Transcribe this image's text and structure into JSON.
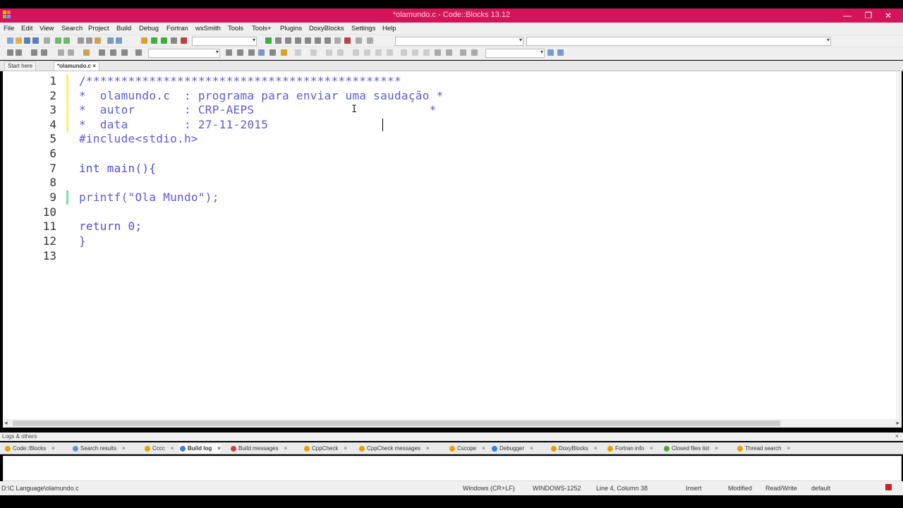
{
  "window": {
    "title": "*olamundo.c - Code::Blocks 13.12",
    "minimize": "—",
    "maximize": "❐",
    "close": "✕"
  },
  "menu": [
    "File",
    "Edit",
    "View",
    "Search",
    "Project",
    "Build",
    "Debug",
    "Fortran",
    "wxSmith",
    "Tools",
    "Tools+",
    "Plugins",
    "DoxyBlocks",
    "Settings",
    "Help"
  ],
  "tabs": [
    {
      "label": "Start here",
      "active": false
    },
    {
      "label": "*olamundo.c",
      "close": "×",
      "active": true
    }
  ],
  "editor": {
    "line_numbers": [
      "1",
      "2",
      "3",
      "4",
      "5",
      "6",
      "7",
      "8",
      "9",
      "10",
      "11",
      "12",
      "13"
    ],
    "lines": [
      "/*********************************************",
      "*  olamundo.c  : programa para enviar uma saudação *",
      "*  autor       : CRP-AEPS                         *",
      "*  data        : 27-11-2015",
      "#include<stdio.h>",
      "",
      "int main(){",
      "",
      "printf(\"Ola Mundo\");",
      "",
      "return 0;",
      "}",
      ""
    ]
  },
  "logs": {
    "header": "Logs & others",
    "tabs": [
      {
        "label": "Code::Blocks",
        "icon_color": "#e8a000"
      },
      {
        "label": "Search results",
        "icon_color": "#6a8fd0"
      },
      {
        "label": "Cccc",
        "icon_color": "#e8a000"
      },
      {
        "label": "Build log",
        "icon_color": "#3a7fd8",
        "active": true
      },
      {
        "label": "Build messages",
        "icon_color": "#d04040"
      },
      {
        "label": "CppCheck",
        "icon_color": "#e8a000"
      },
      {
        "label": "CppCheck messages",
        "icon_color": "#e8a000"
      },
      {
        "label": "Cscope",
        "icon_color": "#e8a000"
      },
      {
        "label": "Debugger",
        "icon_color": "#3a7fd8"
      },
      {
        "label": "DoxyBlocks",
        "icon_color": "#e8a000"
      },
      {
        "label": "Fortran info",
        "icon_color": "#e8a000"
      },
      {
        "label": "Closed files list",
        "icon_color": "#5aa040"
      },
      {
        "label": "Thread search",
        "icon_color": "#e8a000"
      }
    ],
    "close_glyph": "×"
  },
  "status": {
    "path": "D:\\C Language\\olamundo.c",
    "eol": "Windows (CR+LF)",
    "encoding": "WINDOWS-1252",
    "position": "Line 4, Column 38",
    "mode": "Insert",
    "modified": "Modified",
    "access": "Read/Write",
    "profile": "default"
  },
  "colors": {
    "titlebar": "#d4145a",
    "code_text": "#5c5cd6",
    "fold_margin": "#ffee77",
    "changed_line_marker": "#7be0a0"
  }
}
